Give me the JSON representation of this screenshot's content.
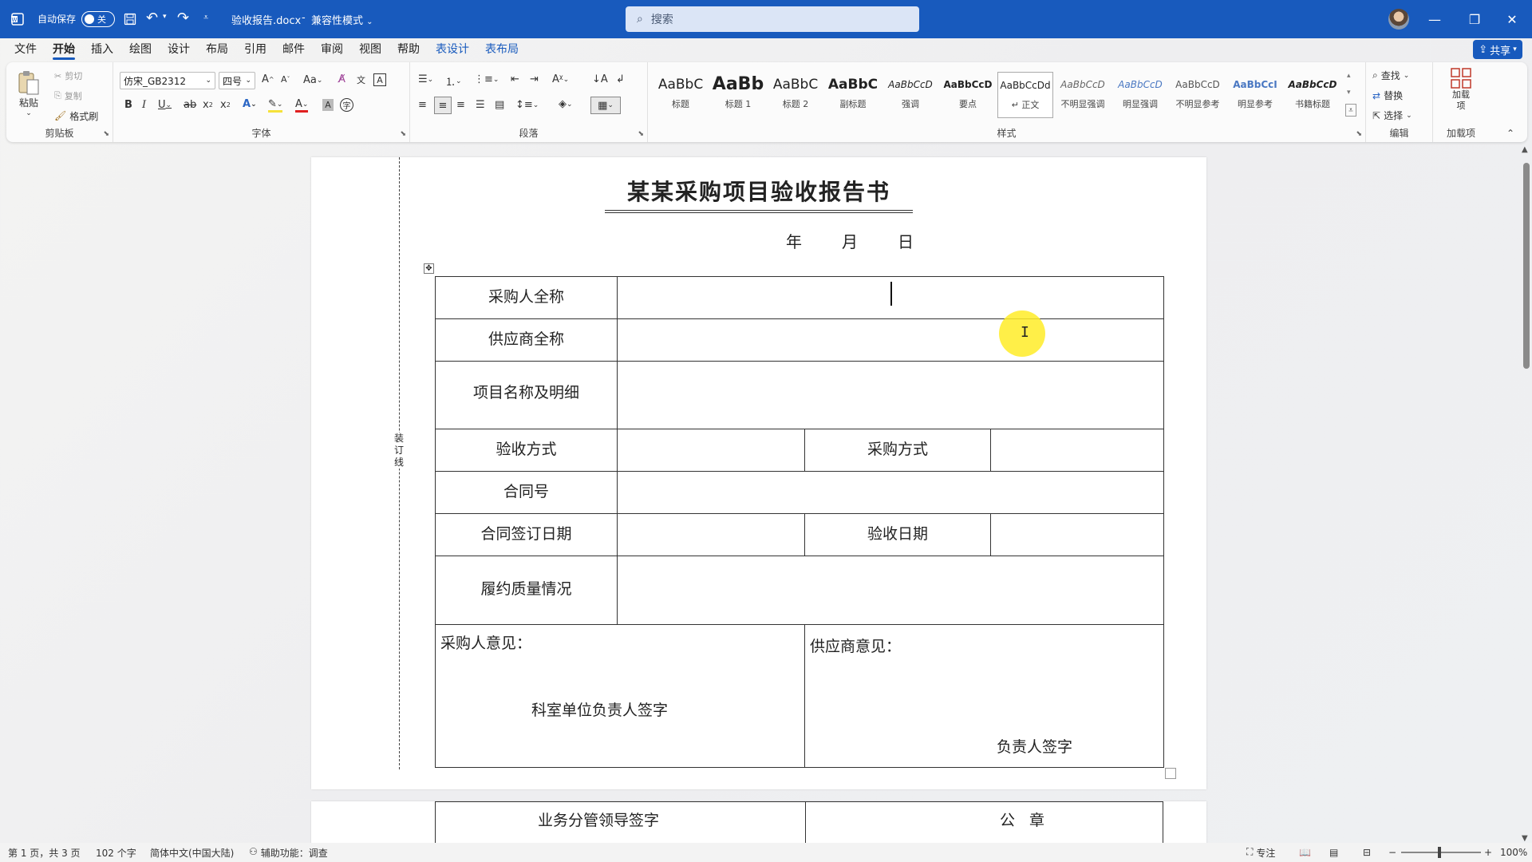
{
  "titlebar": {
    "autosave_label": "自动保存",
    "autosave_state": "关",
    "filename": "验收报告.docx",
    "mode": "兼容性模式",
    "search_placeholder": "搜索"
  },
  "menu": {
    "items": [
      "文件",
      "开始",
      "插入",
      "绘图",
      "设计",
      "布局",
      "引用",
      "邮件",
      "审阅",
      "视图",
      "帮助"
    ],
    "active": "开始",
    "context": [
      "表设计",
      "表布局"
    ],
    "share": "共享"
  },
  "ribbon": {
    "clipboard": {
      "paste": "粘贴",
      "cut": "剪切",
      "copy": "复制",
      "format_painter": "格式刷",
      "label": "剪贴板"
    },
    "font": {
      "name": "仿宋_GB2312",
      "size": "四号",
      "label": "字体"
    },
    "paragraph": {
      "label": "段落"
    },
    "styles": {
      "label": "样式",
      "items": [
        {
          "sample": "AaBbC",
          "name": "标题"
        },
        {
          "sample": "AaBb",
          "name": "标题 1"
        },
        {
          "sample": "AaBbC",
          "name": "标题 2"
        },
        {
          "sample": "AaBbC",
          "name": "副标题"
        },
        {
          "sample": "AaBbCcD",
          "name": "强调"
        },
        {
          "sample": "AaBbCcD",
          "name": "要点"
        },
        {
          "sample": "AaBbCcDd",
          "name": "↵ 正文"
        },
        {
          "sample": "AaBbCcD",
          "name": "不明显强调"
        },
        {
          "sample": "AaBbCcD",
          "name": "明显强调"
        },
        {
          "sample": "AaBbCcD",
          "name": "不明显参考"
        },
        {
          "sample": "AaBbCcI",
          "name": "明显参考"
        },
        {
          "sample": "AaBbCcD",
          "name": "书籍标题"
        }
      ]
    },
    "editing": {
      "find": "查找",
      "replace": "替换",
      "select": "选择",
      "label": "编辑"
    },
    "addins": {
      "button": "加载项",
      "label": "加载项"
    }
  },
  "document": {
    "title": "某某采购项目验收报告书",
    "date": [
      "年",
      "月",
      "日"
    ],
    "binding_label": "装订线",
    "table": {
      "purchaser_name": "采购人全称",
      "supplier_name": "供应商全称",
      "project_detail": "项目名称及明细",
      "acceptance_method": "验收方式",
      "purchase_method": "采购方式",
      "contract_no": "合同号",
      "sign_date": "合同签订日期",
      "acceptance_date": "验收日期",
      "quality": "履约质量情况",
      "purchaser_opinion": "采购人意见：",
      "purchaser_sign": "科室单位负责人签字",
      "supplier_opinion": "供应商意见：",
      "supplier_sign": "负责人签字"
    },
    "page2": {
      "leader_sign": "业务分管领导签字",
      "seal": "公 章"
    }
  },
  "status": {
    "page": "第 1 页，共 3 页",
    "words": "102 个字",
    "language": "简体中文(中国大陆)",
    "accessibility": "辅助功能：调查",
    "focus": "专注",
    "zoom": "100%"
  }
}
